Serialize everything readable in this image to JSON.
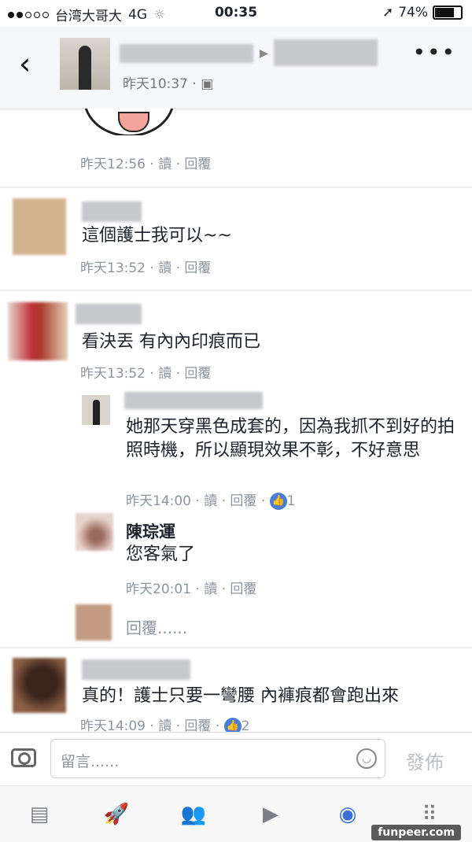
{
  "status_bar": {
    "carrier": "台湾大哥大",
    "network": "4G",
    "time": "00:35",
    "battery": "74%"
  },
  "header": {
    "subtitle": "昨天10:37 · ",
    "more_icon": "more-horizontal-icon"
  },
  "comments": [
    {
      "meta": "昨天12:56 · 讀 · 回覆"
    },
    {
      "text": "這個護士我可以~~",
      "meta": "昨天13:52 · 讀 · 回覆"
    },
    {
      "text": "看決丟 有內內印痕而已",
      "meta": "昨天13:52 · 讀 · 回覆"
    }
  ],
  "replies": [
    {
      "text": "她那天穿黑色成套的，因為我抓不到好的拍照時機，所以顯現效果不彰，不好意思",
      "meta": "昨天14:00 · 讀 · 回覆 · ",
      "likes": "1"
    },
    {
      "name": "陳琮運",
      "text": "您客氣了",
      "meta": "昨天20:01 · 讀 · 回覆"
    }
  ],
  "reply_prompt": "回覆......",
  "last_comment": {
    "text": "真的！護士只要一彎腰 內褲痕都會跑出來",
    "meta": "昨天14:09 · 讀 · 回覆 · ",
    "likes": "2"
  },
  "composer": {
    "placeholder": "留言......",
    "post_label": "發佈"
  },
  "watermark": "funpeer.com",
  "colors": {
    "accent": "#4a7dd8",
    "meta_gray": "#8d949e"
  }
}
